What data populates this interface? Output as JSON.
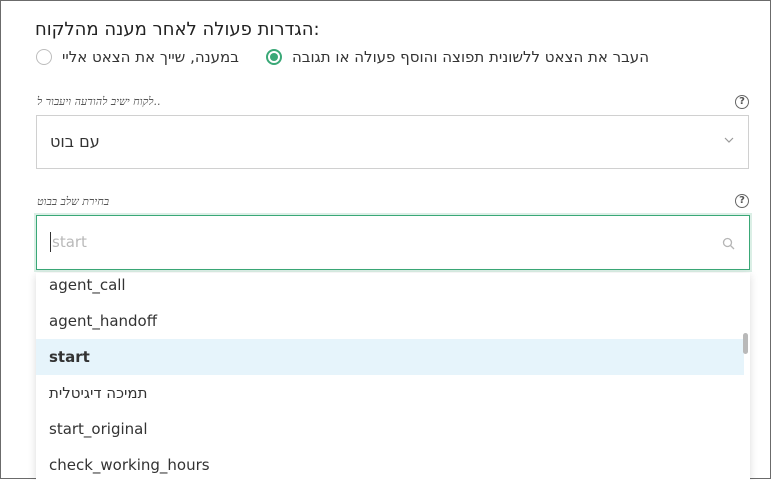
{
  "title": "הגדרות פעולה לאחר מענה מהלקוח:",
  "radio": {
    "option1": "העבר את הצאט ללשונית תפוצה והוסף פעולה או תגובה",
    "option2": "במענה, שייך את הצאט אליי",
    "selected": "option1"
  },
  "field1": {
    "label": "לקוח ישיב להודעה ויעבור ל..",
    "value": "עם בוט",
    "help": "?"
  },
  "field2": {
    "label": "בחירת שלב בבוט",
    "placeholder": "start",
    "help": "?"
  },
  "dropdown": {
    "options": [
      {
        "label": "agent_call",
        "selected": false
      },
      {
        "label": "agent_handoff",
        "selected": false
      },
      {
        "label": "start",
        "selected": true
      },
      {
        "label": "תמיכה דיגיטלית",
        "selected": false
      },
      {
        "label": "start_original",
        "selected": false
      },
      {
        "label": "check_working_hours",
        "selected": false
      }
    ]
  },
  "colors": {
    "accent": "#3aa877",
    "selected_bg": "#e6f4fb",
    "border": "#d0d0d0"
  }
}
